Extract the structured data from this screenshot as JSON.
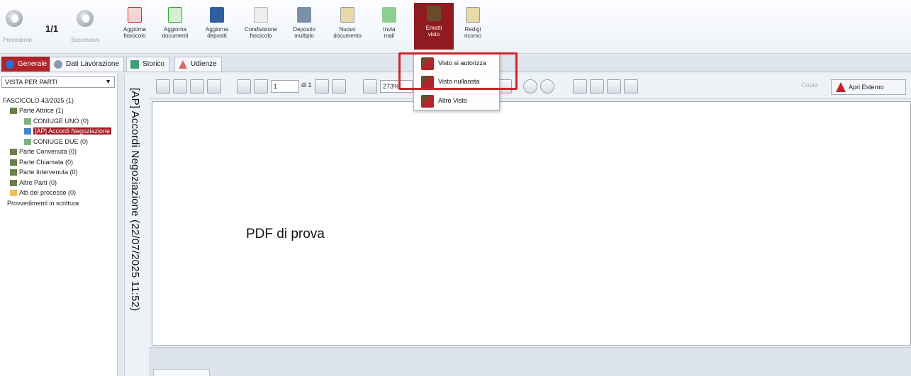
{
  "toolbar": {
    "prev_label": "Precedente",
    "page_counter": "1/1",
    "next_label": "Successivo",
    "buttons": [
      {
        "label": "Aggiorna\nfascicolo",
        "icon": "arrow-down-red-icon"
      },
      {
        "label": "Aggiorna\ndocumenti",
        "icon": "arrow-down-green-icon"
      },
      {
        "label": "Aggiorna\ndepositi",
        "icon": "refresh-blue-icon"
      },
      {
        "label": "Condivisione\nfascicolo",
        "icon": "share-document-icon"
      },
      {
        "label": "Deposito\nmultiplo",
        "icon": "multi-deposit-icon"
      },
      {
        "label": "Nuovo\ndocumento",
        "icon": "new-document-icon"
      },
      {
        "label": "Invia\nmail",
        "icon": "send-mail-icon"
      },
      {
        "label": "Emetti\nvisto",
        "icon": "stamp-icon"
      },
      {
        "label": "Redigi\nricorso",
        "icon": "edit-document-icon"
      }
    ]
  },
  "tabs": [
    "Generale",
    "Dati Lavorazione",
    "Storico",
    "Udienze"
  ],
  "sidebar": {
    "view_select": "VISTA PER PARTI",
    "tree": [
      "FASCICOLO 43/2025 (1)",
      "Parte Attrice (1)",
      "CONIUGE UNO (0)",
      "[AP] Accordi Negoziazione",
      "CONIUGE DUE (0)",
      "Parte Convenuta (0)",
      "Parte Chiamata (0)",
      "Parte Intervenuta (0)",
      "Altre Parti (0)",
      "Atti del processo (0)",
      "Provvedimenti in scrittura"
    ]
  },
  "document": {
    "vertical_title": "[AP] Accordi Negoziazione (22/07/2025 11:52)",
    "body_text": "PDF di prova"
  },
  "pdf_toolbar": {
    "page_value": "1",
    "page_of": "di 1",
    "zoom_value": "273%",
    "copy_label": "Copia",
    "open_external_label": "Apri Esterno"
  },
  "visto_menu": {
    "items": [
      "Visto si autorizza",
      "Visto nullaosta",
      "Altro Visto"
    ]
  },
  "colors": {
    "accent": "#a11d23",
    "highlight": "#d0232b"
  }
}
